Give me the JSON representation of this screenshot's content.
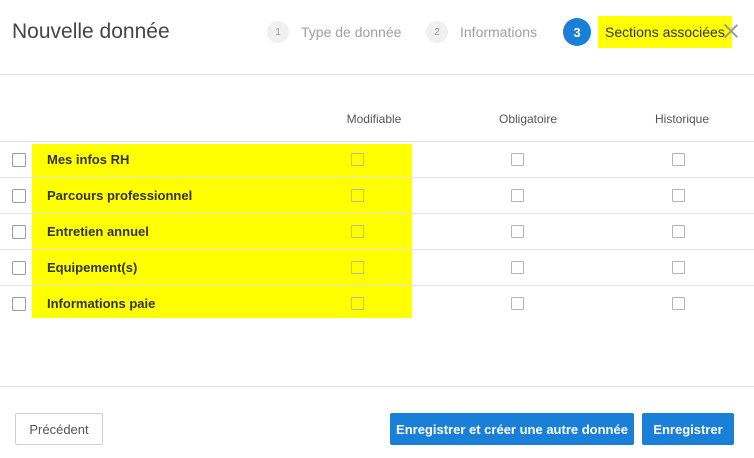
{
  "header": {
    "title": "Nouvelle donnée",
    "steps": [
      {
        "num": "1",
        "label": "Type de donnée",
        "active": false
      },
      {
        "num": "2",
        "label": "Informations",
        "active": false
      },
      {
        "num": "3",
        "label": "Sections associées",
        "active": true
      }
    ],
    "close_icon": "close-icon"
  },
  "table": {
    "columns": [
      "Modifiable",
      "Obligatoire",
      "Historique"
    ],
    "rows": [
      {
        "label": "Mes infos RH"
      },
      {
        "label": "Parcours professionnel"
      },
      {
        "label": "Entretien annuel"
      },
      {
        "label": "Equipement(s)"
      },
      {
        "label": "Informations paie"
      }
    ]
  },
  "footer": {
    "previous_label": "Précédent",
    "save_and_new_label": "Enregistrer et créer une autre donnée",
    "save_label": "Enregistrer"
  },
  "colors": {
    "accent": "#1a7fd6",
    "highlight": "#ffff00"
  }
}
